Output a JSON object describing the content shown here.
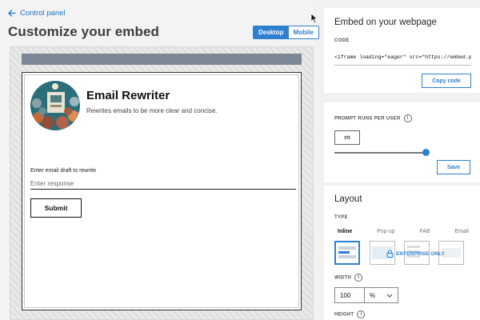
{
  "nav": {
    "back_label": "Control panel"
  },
  "page": {
    "title": "Customize your embed"
  },
  "view_toggle": {
    "desktop": "Desktop",
    "mobile": "Mobile",
    "selected": "Desktop"
  },
  "embed_preview": {
    "app_title": "Email Rewriter",
    "app_description": "Rewrites emails to be more clear and concise.",
    "field_label": "Enter email draft to rewrite",
    "field_placeholder": "Enter response",
    "submit_label": "Submit"
  },
  "embed_card": {
    "title": "Embed on your webpage",
    "code_label": "CODE",
    "code_value": "<iframe loading=\"eager\" src=\"https://embed.pi",
    "copy_label": "Copy code"
  },
  "runs_card": {
    "label": "PROMPT RUNS PER USER",
    "value": "∞",
    "slider_level": 1.0,
    "save_label": "Save"
  },
  "layout_card": {
    "title": "Layout",
    "type_label": "TYPE",
    "types": [
      "Inline",
      "Pop-up",
      "FAB",
      "Email"
    ],
    "selected_type": "Inline",
    "enterprise_label": "ENTERPRISE ONLY",
    "width_label": "WIDTH",
    "width_value": "100",
    "width_unit": "%",
    "height_label": "HEIGHT"
  },
  "colors": {
    "accent": "#2f7fcf",
    "topbar": "#7b8794"
  },
  "icons": [
    "arrow-left-icon",
    "info-icon",
    "lock-icon",
    "chevron-down-icon",
    "cursor-icon"
  ]
}
